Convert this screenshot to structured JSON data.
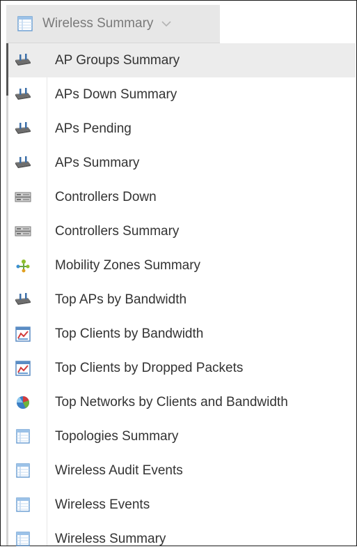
{
  "header": {
    "title": "Wireless Summary",
    "icon": "report-grid-icon",
    "dropdown_icon": "chevron-down-icon"
  },
  "menu": {
    "items": [
      {
        "label": "AP Groups Summary",
        "icon": "access-point-icon",
        "active": true
      },
      {
        "label": "APs Down Summary",
        "icon": "access-point-icon"
      },
      {
        "label": "APs Pending",
        "icon": "access-point-icon"
      },
      {
        "label": "APs Summary",
        "icon": "access-point-icon"
      },
      {
        "label": "Controllers Down",
        "icon": "controller-icon"
      },
      {
        "label": "Controllers Summary",
        "icon": "controller-icon"
      },
      {
        "label": "Mobility Zones Summary",
        "icon": "mobility-zone-icon"
      },
      {
        "label": "Top APs by Bandwidth",
        "icon": "access-point-icon"
      },
      {
        "label": "Top Clients by Bandwidth",
        "icon": "chart-report-icon"
      },
      {
        "label": "Top Clients by Dropped Packets",
        "icon": "chart-report-icon"
      },
      {
        "label": "Top Networks by Clients and Bandwidth",
        "icon": "pie-chart-icon"
      },
      {
        "label": "Topologies Summary",
        "icon": "report-grid-icon"
      },
      {
        "label": "Wireless Audit Events",
        "icon": "report-grid-icon"
      },
      {
        "label": "Wireless Events",
        "icon": "report-grid-icon"
      },
      {
        "label": "Wireless Summary",
        "icon": "report-grid-icon"
      }
    ]
  },
  "colors": {
    "header_bg": "#e7e7e7",
    "header_text": "#7a7a7a",
    "item_text": "#333333",
    "active_bg": "#ececec",
    "icon_blue": "#3b7fc4"
  }
}
